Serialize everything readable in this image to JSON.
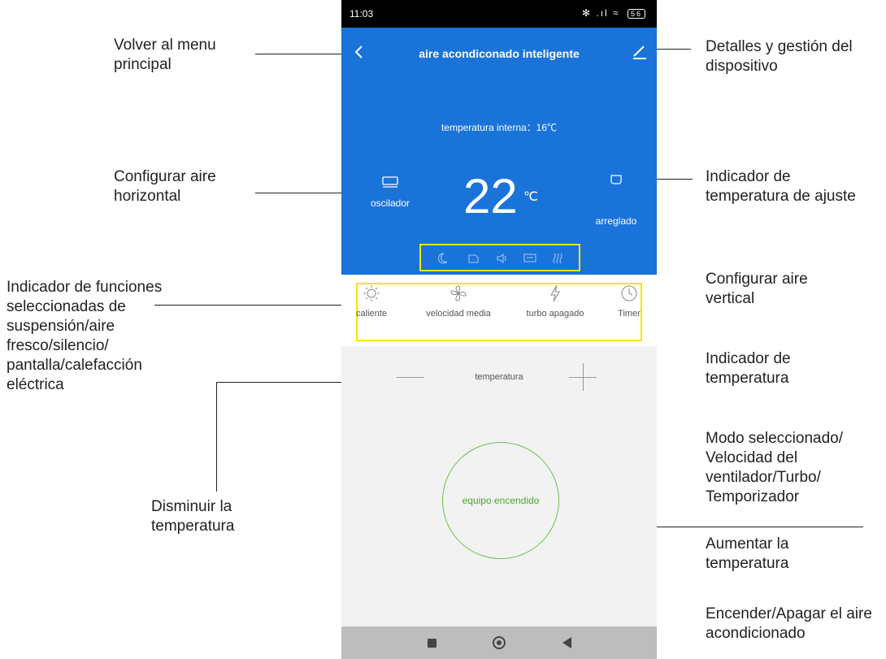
{
  "phone": {
    "status": {
      "time": "11:03",
      "icons": "✻ .ıl ≈",
      "battery": "56"
    },
    "header": {
      "title": "aire acondiconado inteligente"
    },
    "inner_temp": "temperatura interna：16℃",
    "oscillator_label": "oscilador",
    "set_temp": "22",
    "set_temp_unit": "℃",
    "fixed_label": "arreglado",
    "modes": [
      {
        "label": "caliente"
      },
      {
        "label": "velocidad media"
      },
      {
        "label": "turbo apagado"
      },
      {
        "label": "Timer"
      }
    ],
    "temp_label": "temperatura",
    "power_label": "equipo encendido"
  },
  "annotations": {
    "back": "Volver al menu principal",
    "details": "Detalles y gestión del dispositivo",
    "horizontal": "Configurar aire horizontal",
    "set_temp_indicator": "Indicador de temperatura de ajuste",
    "functions": "Indicador de funciones seleccionadas de suspensión/aire fresco/silencio/ pantalla/calefacción eléctrica",
    "vertical": "Configurar aire vertical",
    "temp_indicator": "Indicador de temperatura",
    "mode_selected": "Modo seleccionado/ Velocidad del ventilador/Turbo/ Temporizador",
    "decrease": "Disminuir la temperatura",
    "increase": "Aumentar la temperatura",
    "power": "Encender/Apagar el aire acondicionado"
  },
  "colors": {
    "accent_blue": "#1a73d9",
    "highlight_yellow": "#f2e600",
    "power_green": "#4aa52e"
  }
}
